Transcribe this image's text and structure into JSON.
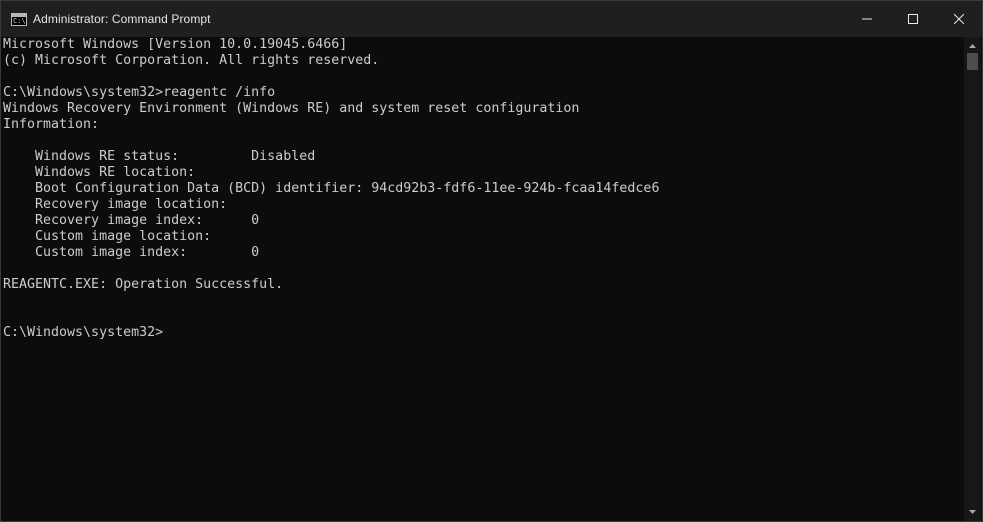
{
  "window": {
    "title": "Administrator: Command Prompt",
    "icon_text": "C:\\"
  },
  "controls": {
    "minimize": "minimize-icon",
    "maximize": "maximize-icon",
    "close": "close-icon"
  },
  "console": {
    "lines": [
      "Microsoft Windows [Version 10.0.19045.6466]",
      "(c) Microsoft Corporation. All rights reserved.",
      "",
      "C:\\Windows\\system32>reagentc /info",
      "Windows Recovery Environment (Windows RE) and system reset configuration",
      "Information:",
      "",
      "    Windows RE status:         Disabled",
      "    Windows RE location:",
      "    Boot Configuration Data (BCD) identifier: 94cd92b3-fdf6-11ee-924b-fcaa14fedce6",
      "    Recovery image location:",
      "    Recovery image index:      0",
      "    Custom image location:",
      "    Custom image index:        0",
      "",
      "REAGENTC.EXE: Operation Successful.",
      "",
      "",
      "C:\\Windows\\system32>"
    ]
  },
  "colors": {
    "background": "#0c0c0c",
    "text": "#cccccc",
    "titlebar": "#1f1f1f"
  }
}
